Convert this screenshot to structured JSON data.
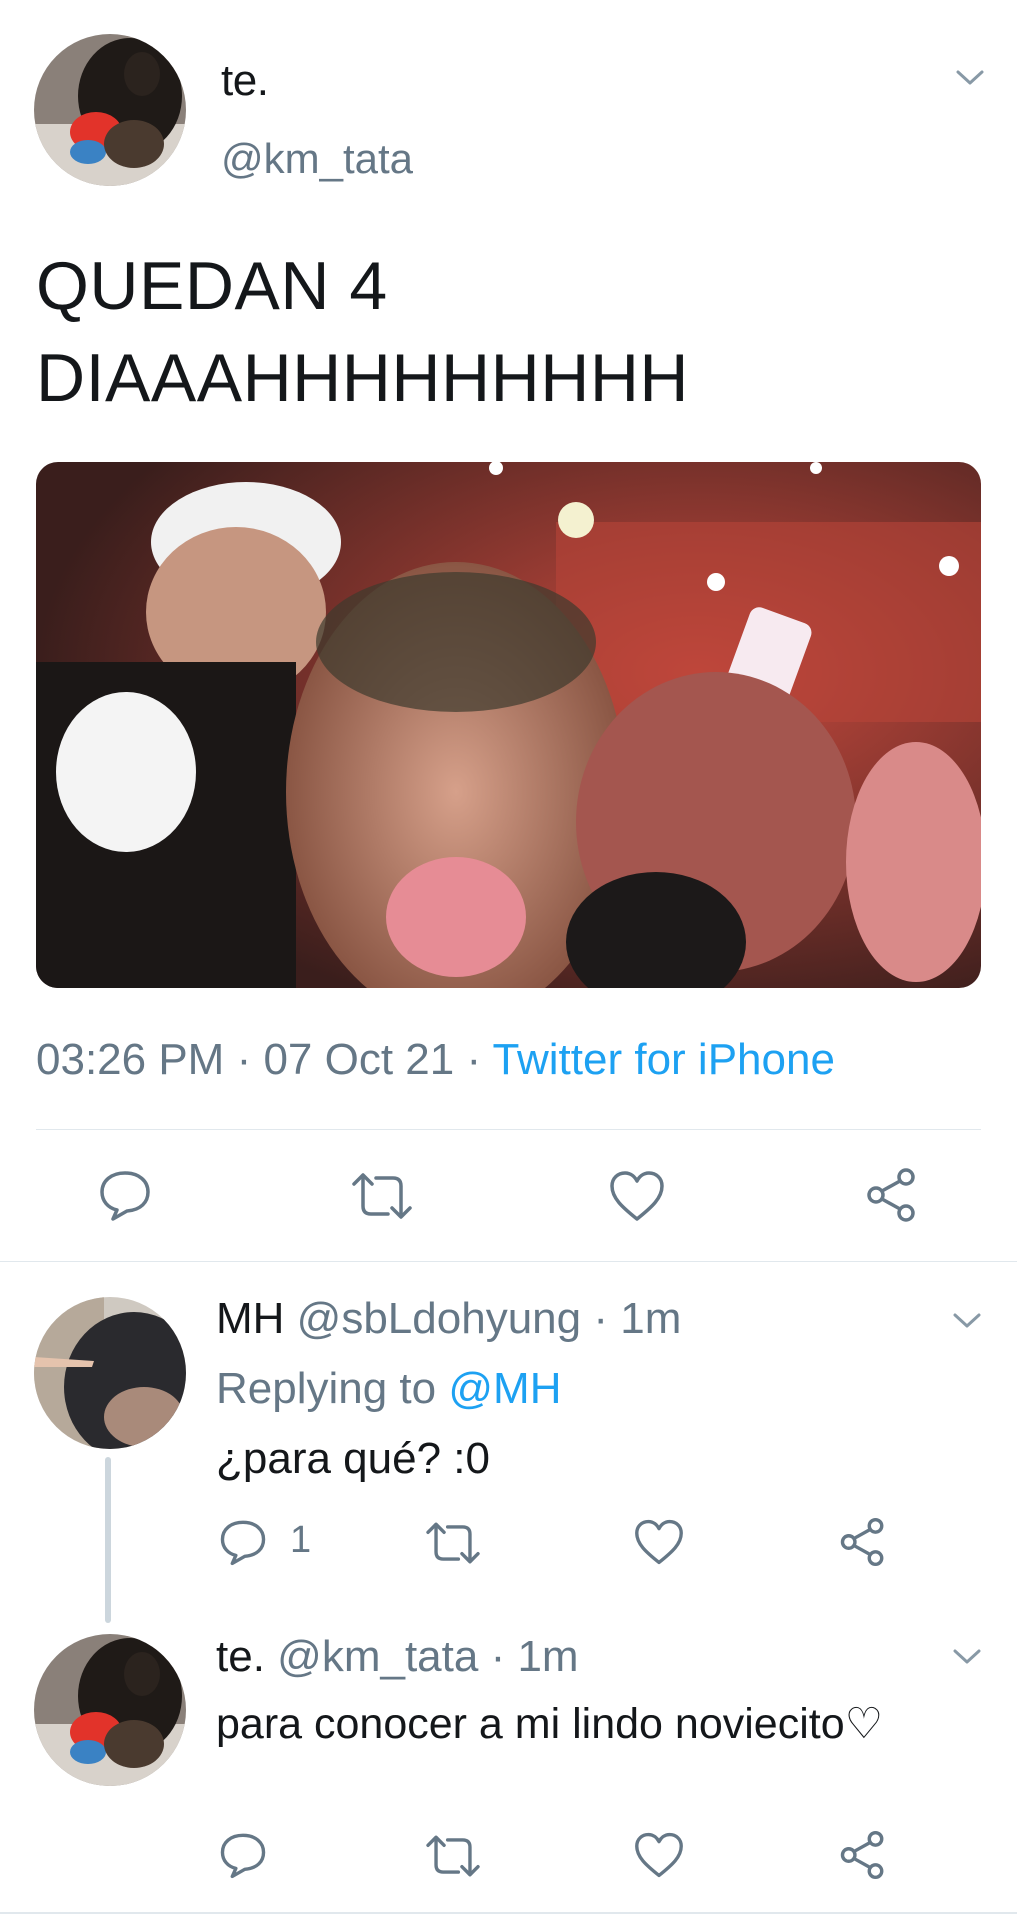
{
  "main_tweet": {
    "name": "te.",
    "handle": "@km_tata",
    "text_line1": "QUEDAN 4",
    "text_line2": "DIAAAHHHHHHHHH",
    "time": "03:26 PM",
    "date": "07 Oct 21",
    "source": "Twitter for iPhone",
    "separator": " · "
  },
  "actions": {
    "reply": "reply-icon",
    "retweet": "retweet-icon",
    "like": "heart-icon",
    "share": "share-icon"
  },
  "reply1": {
    "name": "MH",
    "handle": "@sbLdohyung",
    "time": "· 1m",
    "replying_prefix": "Replying to",
    "replying_to": "@MH",
    "text": "¿para qué? :0",
    "reply_count": "1"
  },
  "reply2": {
    "name": "te.",
    "handle": "@km_tata",
    "time": "· 1m",
    "text": "para conocer a mi lindo noviecito♡"
  },
  "colors": {
    "accent": "#1da1f2",
    "muted": "#657786",
    "text": "#14171a",
    "divider": "#e1e8ed"
  }
}
